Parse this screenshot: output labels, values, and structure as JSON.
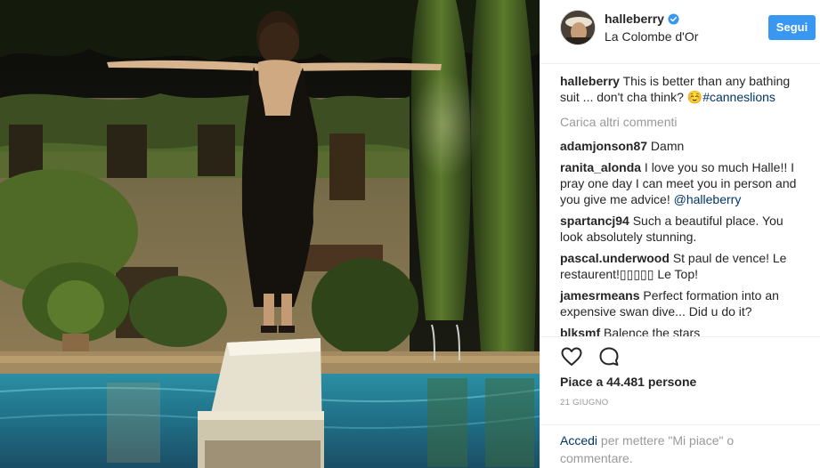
{
  "header": {
    "username": "halleberry",
    "location": "La Colombe d'Or",
    "follow_label": "Segui"
  },
  "caption": {
    "username": "halleberry",
    "text": "This is better than any bathing suit ... don't cha think? ☺️",
    "hashtag": "#canneslions"
  },
  "load_more": "Carica altri commenti",
  "comments": [
    {
      "username": "adamjonson87",
      "text": "Damn",
      "mention": ""
    },
    {
      "username": "ranita_alonda",
      "text": "I love you so much Halle!! I pray one day I can meet you in person and you give me advice! ",
      "mention": "@halleberry"
    },
    {
      "username": "spartancj94",
      "text": "Such a beautiful place. You look absolutely stunning.",
      "mention": ""
    },
    {
      "username": "pascal.underwood",
      "text": "St paul de vence! Le restaurent!▯▯▯▯▯ Le Top!",
      "mention": ""
    },
    {
      "username": "jamesrmeans",
      "text": "Perfect formation into an expensive swan dive... Did u do it?",
      "mention": ""
    },
    {
      "username": "blksmf",
      "text": "Balence the stars",
      "mention": ""
    }
  ],
  "actions": {
    "like_icon": "heart-outline-icon",
    "comment_icon": "speech-bubble-icon",
    "likes": "Piace a 44.481 persone",
    "date": "21 GIUGNO"
  },
  "login": {
    "link": "Accedi",
    "text": " per mettere \"Mi piace\" o commentare."
  },
  "colors": {
    "accent": "#3897f0",
    "link": "#003569",
    "muted": "#999999",
    "text": "#262626"
  }
}
